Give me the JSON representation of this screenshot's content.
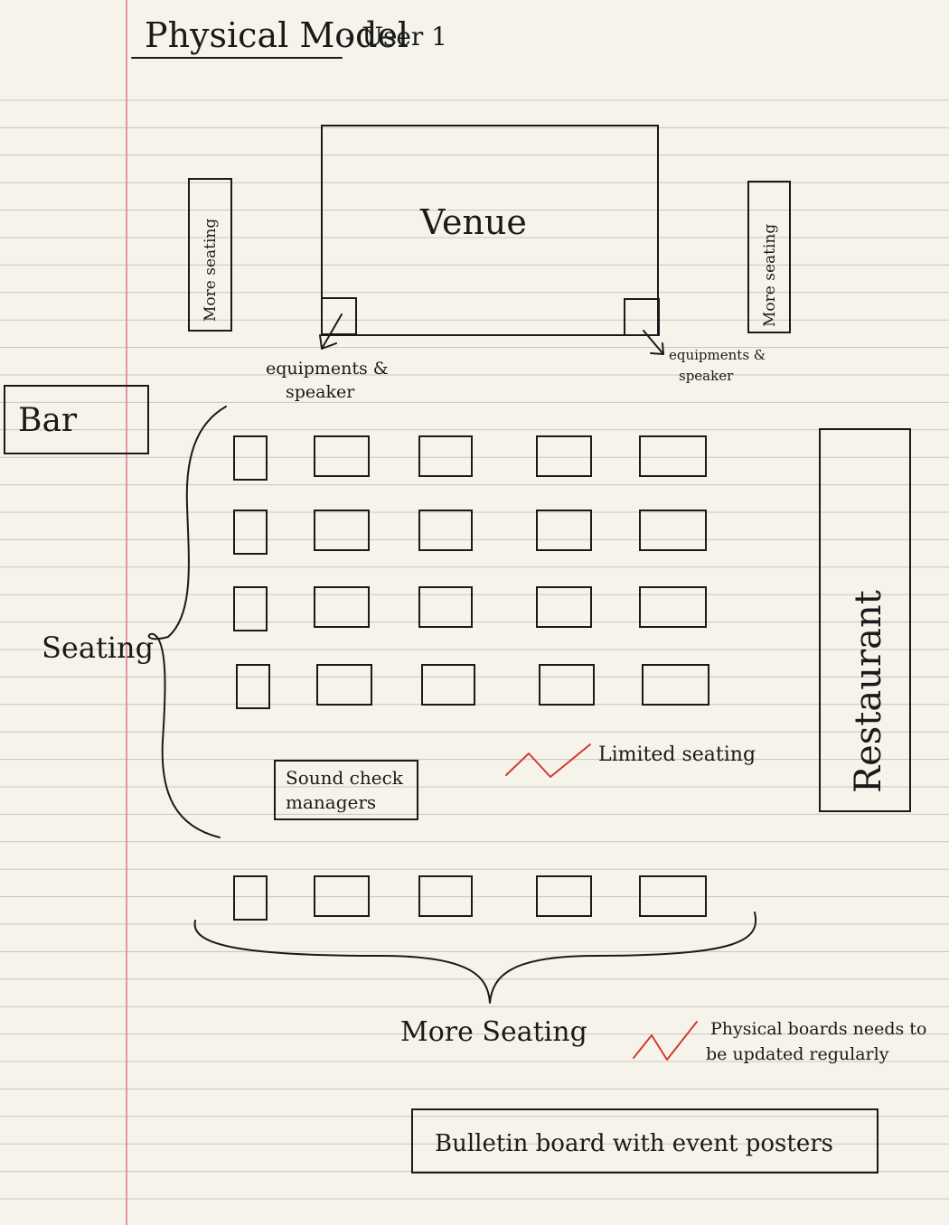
{
  "title": "Physical Model",
  "subtitle": "- User 1",
  "labels": {
    "venue": "Venue",
    "more_seating_left": "More seating",
    "more_seating_right": "More seating",
    "equipment_left_line1": "equipments &",
    "equipment_left_line2": "speaker",
    "equipment_right_line1": "equipments &",
    "equipment_right_line2": "speaker",
    "bar": "Bar",
    "restaurant": "Restaurant",
    "seating": "Seating",
    "sound_check_line1": "Sound check",
    "sound_check_line2": "managers",
    "limited_seating": "Limited seating",
    "more_seating_bottom": "More Seating",
    "boards_note_line1": "Physical boards needs to",
    "boards_note_line2": "be updated regularly",
    "bulletin_board": "Bulletin board with event posters"
  },
  "colors": {
    "paper": "#f6f4ea",
    "ruled_line": "#c9c6bd",
    "margin_line": "#e07a8a",
    "ink": "#1a1a1a",
    "warning": "#d23a35"
  }
}
